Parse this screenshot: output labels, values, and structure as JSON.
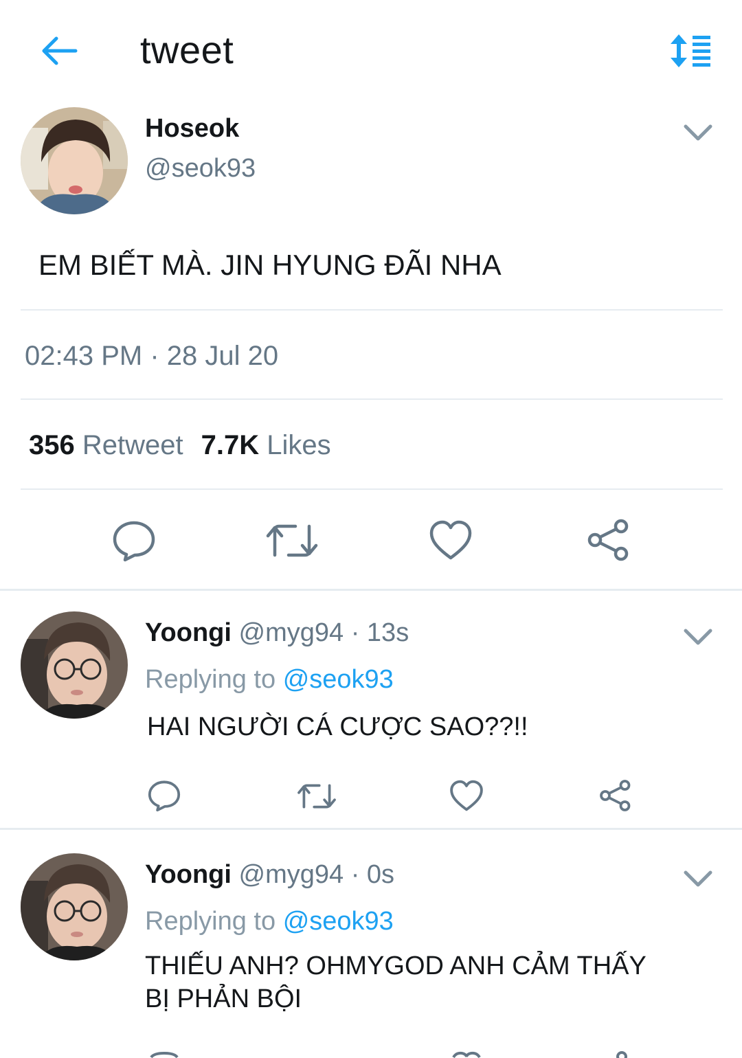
{
  "header": {
    "title": "tweet",
    "accent": "#1da1f2"
  },
  "tweet": {
    "name": "Hoseok",
    "handle": "@seok93",
    "text": "EM BIẾT MÀ. JIN HYUNG ĐÃI NHA",
    "time": "02:43 PM",
    "separator": "·",
    "date": "28 Jul 20",
    "retweets_count": "356",
    "retweets_label": "Retweet",
    "likes_count": "7.7K",
    "likes_label": "Likes"
  },
  "replies": [
    {
      "name": "Yoongi",
      "handle": "@myg94",
      "separator": "·",
      "time": "13s",
      "replying_label": "Replying to",
      "replying_handle": "@seok93",
      "text": "HAI NGƯỜI CÁ CƯỢC SAO??!!"
    },
    {
      "name": "Yoongi",
      "handle": "@myg94",
      "separator": "·",
      "time": "0s",
      "replying_label": "Replying to",
      "replying_handle": "@seok93",
      "text_line1": "THIẾU ANH? OHMYGOD ANH CẢM THẤY",
      "text_line2": "BỊ PHẢN BỘI"
    }
  ],
  "icons": {
    "back": "arrow-left-icon",
    "sort": "sort-list-icon",
    "chevron": "chevron-down-icon",
    "reply": "reply-bubble-icon",
    "retweet": "retweet-icon",
    "like": "heart-icon",
    "share": "share-icon"
  }
}
